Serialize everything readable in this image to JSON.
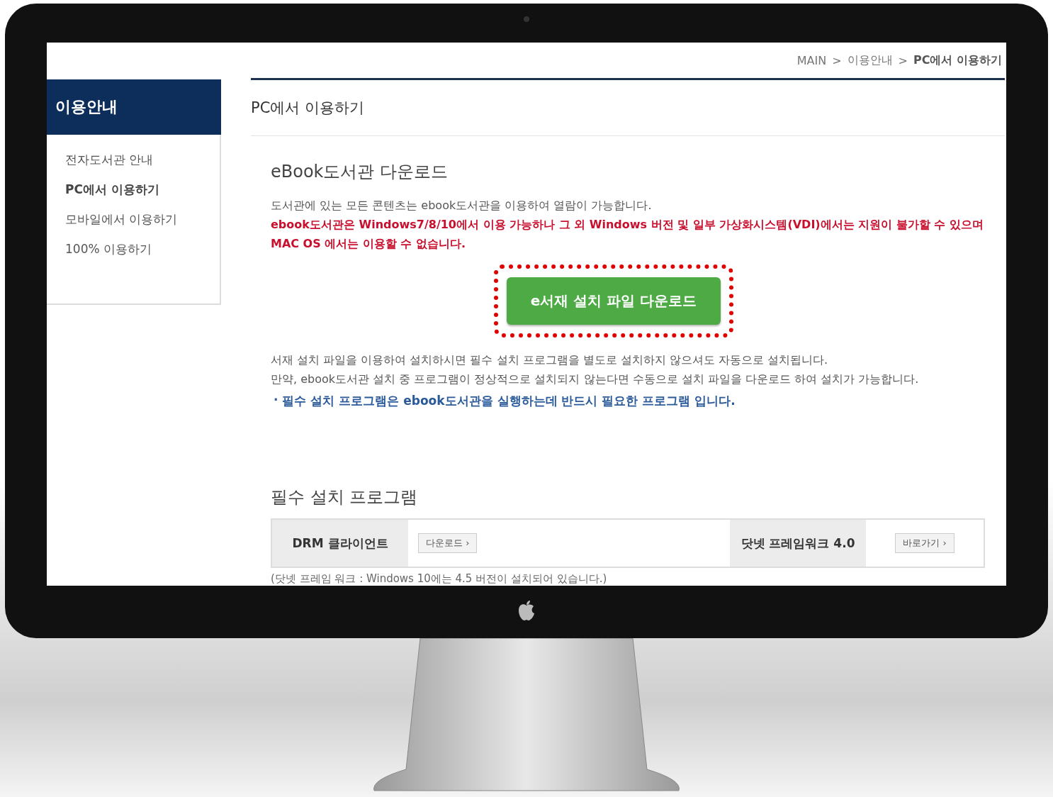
{
  "breadcrumb": [
    {
      "kind": "link",
      "label": "MAIN"
    },
    {
      "kind": "separator",
      "label": ">"
    },
    {
      "kind": "link",
      "label": "이용안내"
    },
    {
      "kind": "separator",
      "label": ">"
    },
    {
      "kind": "current",
      "label": "PC에서 이용하기"
    }
  ],
  "sidebar": {
    "title": "이용안내",
    "items": [
      {
        "label": "전자도서관 안내",
        "selected": false
      },
      {
        "label": "PC에서 이용하기",
        "selected": true
      },
      {
        "label": "모바일에서 이용하기",
        "selected": false
      },
      {
        "label": "100% 이용하기",
        "selected": false
      }
    ]
  },
  "page_title": "PC에서 이용하기",
  "section": {
    "title": "eBook도서관 다운로드",
    "intro": "도서관에 있는 모든 콘텐츠는 ebook도서관을 이용하여 열람이 가능합니다.",
    "warning": "ebook도서관은 Windows7/8/10에서 이용 가능하나 그 외 Windows 버전 및 일부 가상화시스템(VDI)에서는 지원이 불가할 수 있으며 MAC OS 에서는 이용할 수 없습니다.",
    "download_button": "e서재 설치 파일 다운로드",
    "highlighted": true,
    "notes": [
      "서재 설치 파일을 이용하여 설치하시면 필수 설치 프로그램을 별도로 설치하지 않으셔도 자동으로 설치됩니다.",
      "만약, ebook도서관 설치 중 프로그램이 정상적으로 설치되지 않는다면 수동으로 설치 파일을 다운로드 하여 설치가 가능합니다."
    ],
    "bullet_mark": "·",
    "bullet": "필수 설치 프로그램은 ebook도서관을 실행하는데 반드시 필요한 프로그램 입니다."
  },
  "programs": {
    "title": "필수 설치 프로그램",
    "rows": [
      {
        "name": "DRM 클라이언트",
        "action": "다운로드 ›"
      },
      {
        "name": "닷넷 프레임워크 4.0",
        "action": "바로가기 ›"
      }
    ],
    "footnote": "(닷넷 프레임 워크 : Windows 10에는 4.5 버전이 설치되어 있습니다.)"
  }
}
